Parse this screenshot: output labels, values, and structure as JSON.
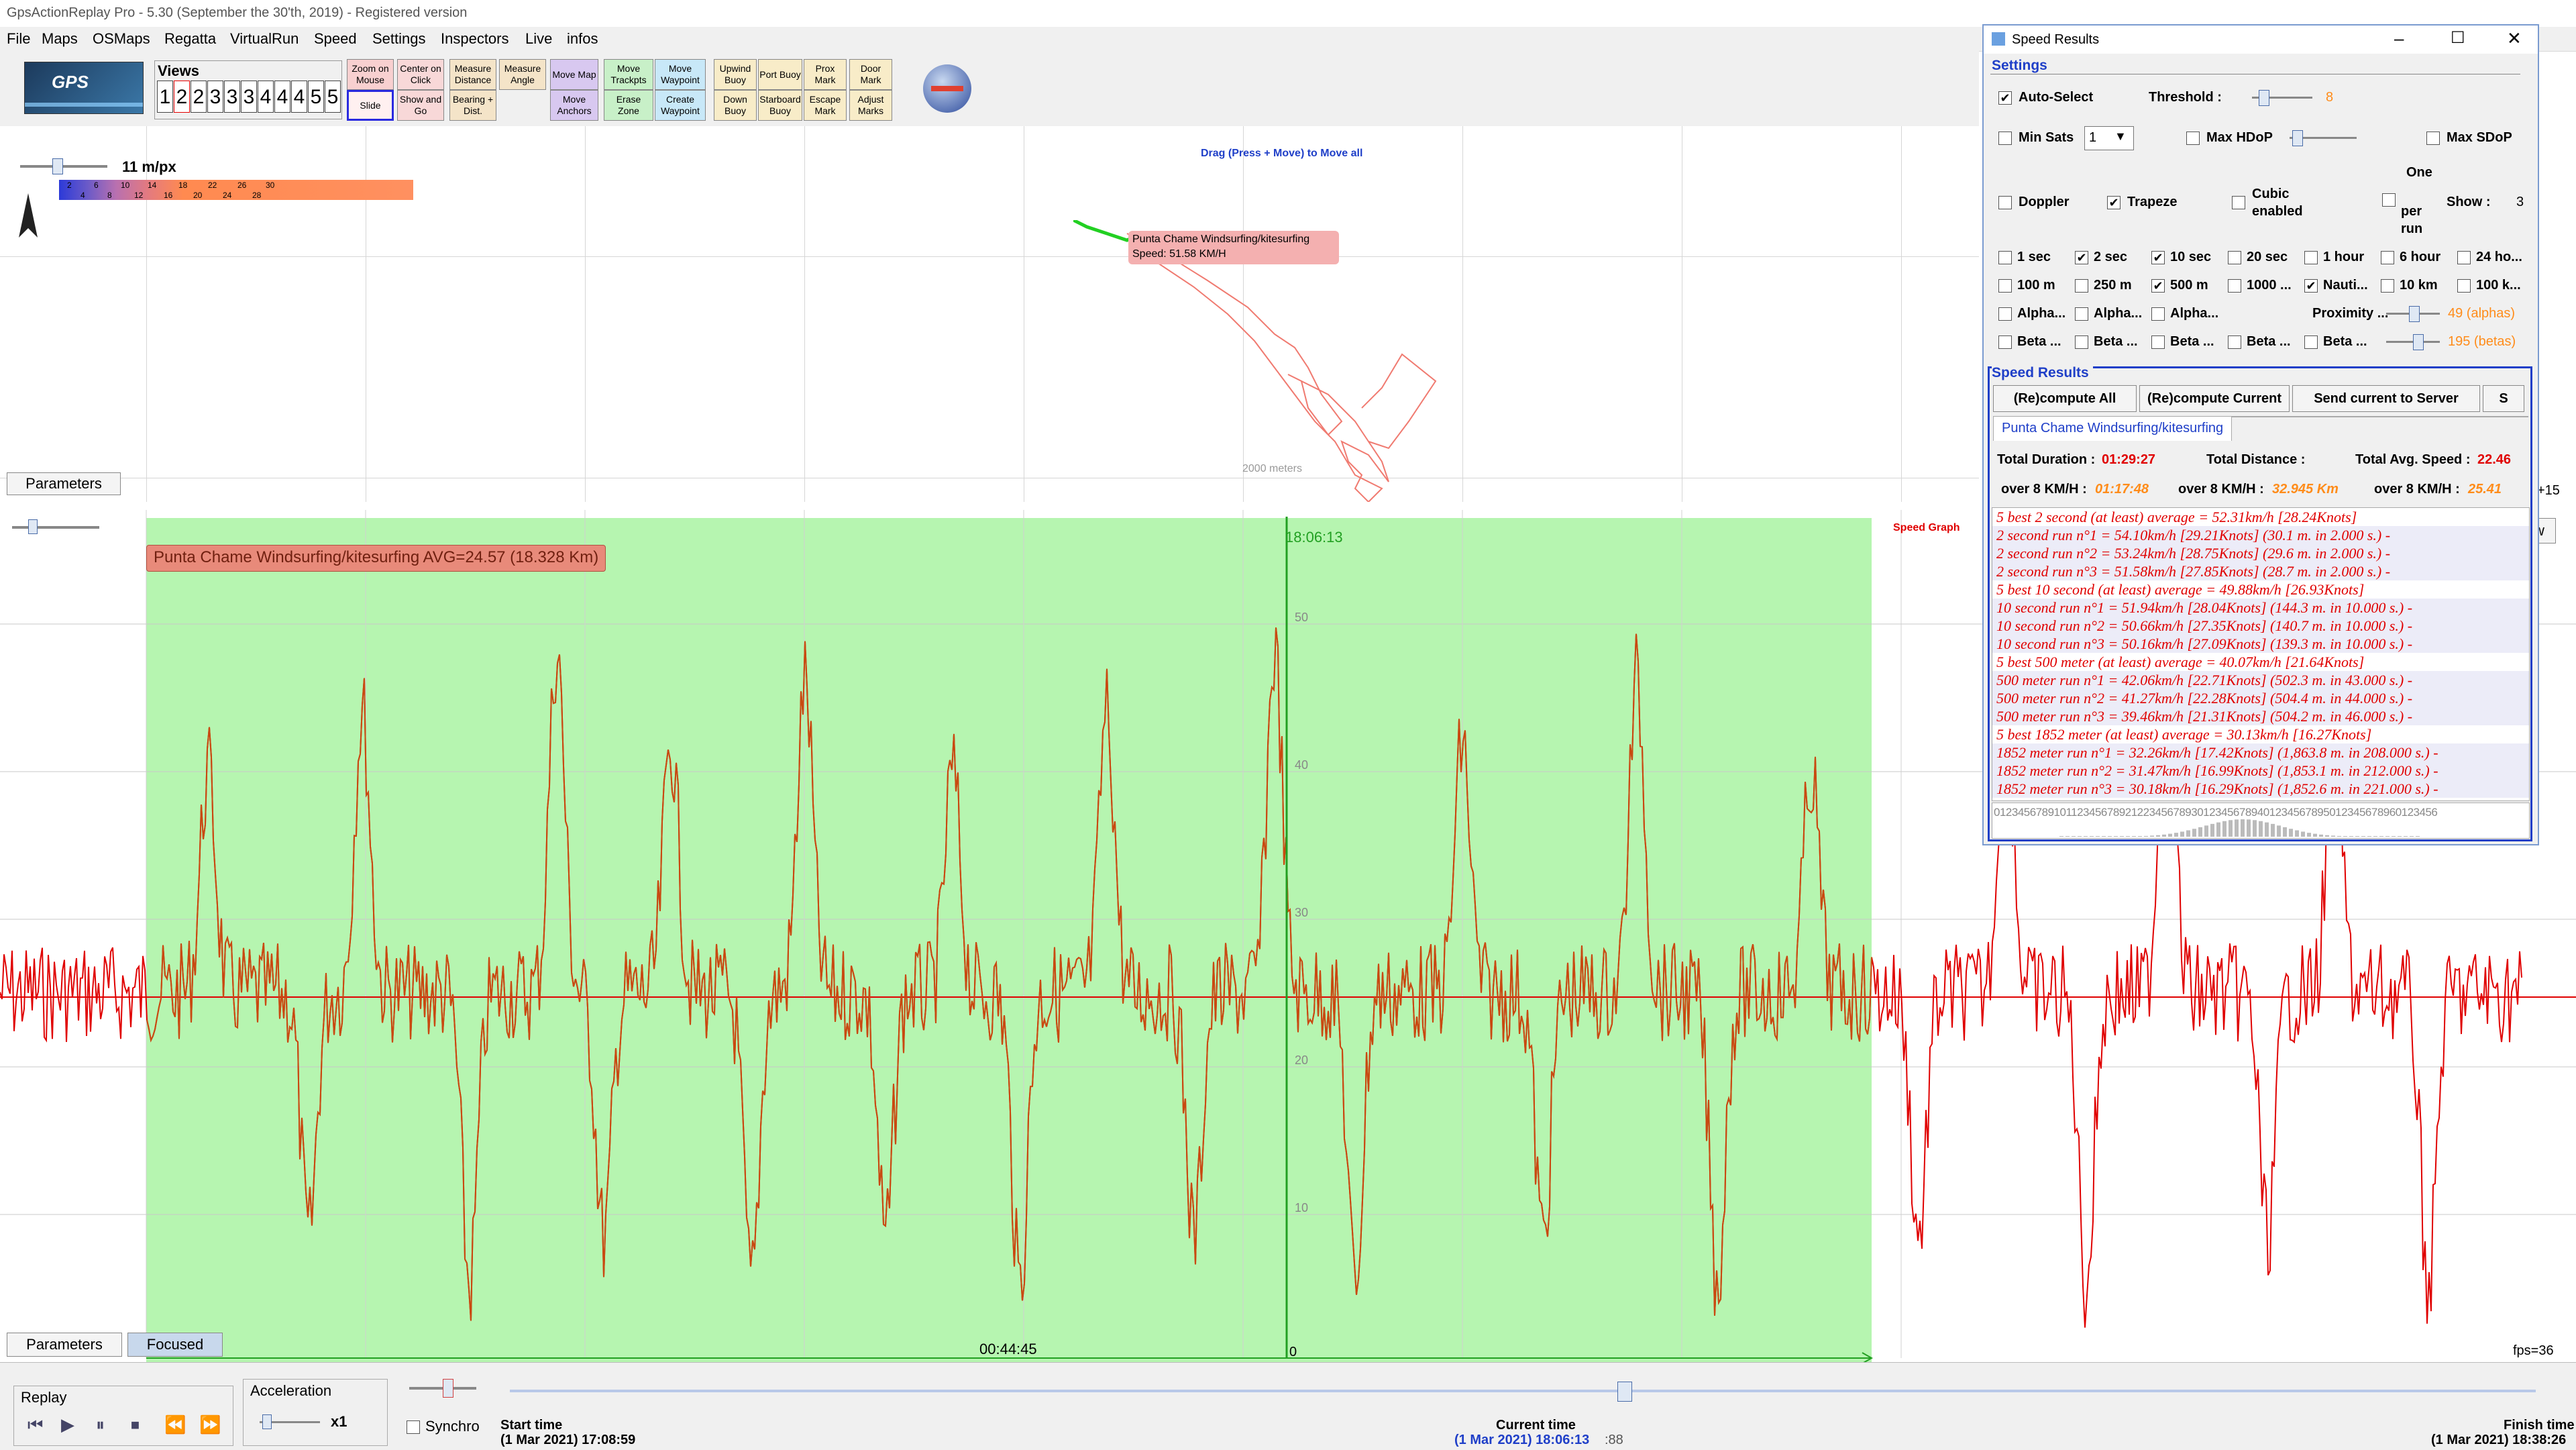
{
  "title_bar": {
    "text": "GpsActionReplay Pro - 5.30  (September the 30'th, 2019)   - Registered version"
  },
  "menu": [
    "File",
    "Maps",
    "OSMaps",
    "Regatta",
    "VirtualRun",
    "Speed",
    "Settings",
    "Inspectors",
    "Live",
    "infos"
  ],
  "toolbar": {
    "views_label": "Views",
    "views": [
      "1",
      "2",
      "2",
      "3",
      "3",
      "3",
      "4",
      "4",
      "4",
      "5",
      "5"
    ],
    "buttons": {
      "zoom_on_mouse": "Zoom on Mouse",
      "slide": "Slide",
      "center_on_click": "Center on Click",
      "show_and_go": "Show and Go",
      "measure_distance": "Measure Distance",
      "bearing_dist": "Bearing + Dist.",
      "measure_angle": "Measure Angle",
      "move_map": "Move Map",
      "move_anchors": "Move Anchors",
      "move_trackpts": "Move Trackpts",
      "erase_zone": "Erase Zone",
      "move_waypoint": "Move Waypoint",
      "create_waypoint": "Create Waypoint",
      "upwind_buoy": "Upwind Buoy",
      "down_buoy": "Down Buoy",
      "port_buoy": "Port Buoy",
      "starboard_buoy": "Starboard Buoy",
      "prox_mark": "Prox Mark",
      "escape_mark": "Escape Mark",
      "door_mark": "Door Mark",
      "adjust_marks": "Adjust Marks"
    }
  },
  "map": {
    "scale_label": "11 m/px",
    "hint": "Drag (Press + Move) to Move all",
    "track_label": "Punta Chame Windsurfing/kitesurfing",
    "track_speed": "Speed: 51.58 KM/H",
    "distance_label": "2000 meters",
    "parameters_button": "Parameters",
    "color_scale_top": [
      "2",
      "6",
      "10",
      "14",
      "18",
      "22",
      "26",
      "30"
    ],
    "color_scale_bottom": [
      "4",
      "8",
      "12",
      "16",
      "20",
      "24",
      "28"
    ]
  },
  "graph": {
    "title_badge": "Punta Chame Windsurfing/kitesurfing AVG=24.57 (18.328 Km)",
    "speed_graph_label": "Speed Graph",
    "cursor_time": "18:06:13",
    "mid_time": "00:44:45",
    "zero_label": "0",
    "fps": "fps=36",
    "y_labels": [
      "50",
      "40",
      "30",
      "20",
      "10"
    ],
    "parameters_button": "Parameters",
    "focused_button": "Focused",
    "right_label_1": "+15",
    "right_button": "w"
  },
  "replay": {
    "replay_label": "Replay",
    "acceleration_label": "Acceleration",
    "acceleration_value": "x1",
    "synchro_label": "Synchro",
    "start_label": "Start time",
    "start_value": "(1 Mar 2021) 17:08:59",
    "current_label": "Current time",
    "current_value": "(1 Mar 2021) 18:06:13",
    "current_frac": ":88",
    "finish_label": "Finish time",
    "finish_value": "(1 Mar 2021) 18:38:26",
    "slider_progress": 0.55
  },
  "speed_results": {
    "window_title": "Speed Results",
    "settings_title": "Settings",
    "auto_select": "Auto-Select",
    "threshold_label": "Threshold :",
    "threshold_value": "8",
    "min_sats": "Min Sats",
    "min_sats_value": "1",
    "max_hdop": "Max HDoP",
    "max_sdop": "Max SDoP",
    "doppler": "Doppler",
    "trapeze": "Trapeze",
    "cubic": "Cubic enabled",
    "one_per_run": "One per run",
    "show_label": "Show :",
    "show_value": "3",
    "durations_row1": [
      "1 sec",
      "2 sec",
      "10 sec",
      "20 sec",
      "1 hour",
      "6 hour",
      "24 ho..."
    ],
    "durations_row1_checked": [
      false,
      true,
      true,
      false,
      false,
      false,
      false
    ],
    "durations_row2": [
      "100 m",
      "250 m",
      "500 m",
      "1000 ...",
      "Nauti...",
      "10 km",
      "100 k..."
    ],
    "durations_row2_checked": [
      false,
      false,
      true,
      false,
      true,
      false,
      false
    ],
    "alpha_row": [
      "Alpha...",
      "Alpha...",
      "Alpha..."
    ],
    "proximity_label": "Proximity ...",
    "alpha_value": "49 (alphas)",
    "beta_row": [
      "Beta ...",
      "Beta ...",
      "Beta ...",
      "Beta ...",
      "Beta ..."
    ],
    "beta_value": "195 (betas)",
    "results_title": "Speed Results",
    "recompute_all": "(Re)compute All",
    "recompute_current": "(Re)compute Current",
    "send_current": "Send current to Server",
    "send_more": "S",
    "tab_label": "Punta Chame Windsurfing/kitesurfing",
    "total_duration_label": "Total Duration :",
    "total_duration_value": "01:29:27",
    "total_distance_label": "Total Distance :",
    "total_avg_label": "Total Avg. Speed :",
    "total_avg_value": "22.46",
    "over1_label": "over 8 KM/H :",
    "over1_value": "01:17:48",
    "over2_label": "over 8 KM/H :",
    "over2_value": "32.945 Km",
    "over3_label": "over 8 KM/H :",
    "over3_value": "25.41",
    "lines": [
      "5 best 2 second (at least) average = 52.31km/h [28.24Knots]",
      "2 second run n°1 = 54.10km/h [29.21Knots] (30.1 m. in 2.000 s.) -",
      "2 second run n°2 = 53.24km/h [28.75Knots] (29.6 m. in 2.000 s.) -",
      "2 second run n°3 = 51.58km/h [27.85Knots] (28.7 m. in 2.000 s.) -",
      "5 best 10 second (at least) average = 49.88km/h [26.93Knots]",
      "10 second run n°1 = 51.94km/h [28.04Knots] (144.3 m. in 10.000 s.) -",
      "10 second run n°2 = 50.66km/h [27.35Knots] (140.7 m. in 10.000 s.) -",
      "10 second run n°3 = 50.16km/h [27.09Knots] (139.3 m. in 10.000 s.) -",
      "5 best 500 meter (at least) average = 40.07km/h [21.64Knots]",
      "500 meter run n°1 = 42.06km/h [22.71Knots] (502.3 m. in 43.000 s.) -",
      "500 meter run n°2 = 41.27km/h [22.28Knots] (504.4 m. in 44.000 s.) -",
      "500 meter run n°3 = 39.46km/h [21.31Knots] (504.2 m. in 46.000 s.) -",
      "5 best 1852 meter (at least) average = 30.13km/h [16.27Knots]",
      "1852 meter run n°1 = 32.26km/h [17.42Knots] (1,863.8 m. in 208.000 s.) -",
      "1852 meter run n°2 = 31.47km/h [16.99Knots] (1,853.1 m. in 212.000 s.) -",
      "1852 meter run n°3 = 30.18km/h [16.29Knots] (1,852.6 m. in 221.000 s.) -"
    ],
    "histogram_axis": "01234567891011234567892122345678930123456789401234567895012345678960123456"
  },
  "colors": {
    "track_red": "#e00000",
    "track_brown": "#c84a10",
    "focus_green": "#b6f5b0",
    "accent_blue": "#1f3fc8",
    "orange": "#ff8c1a"
  }
}
